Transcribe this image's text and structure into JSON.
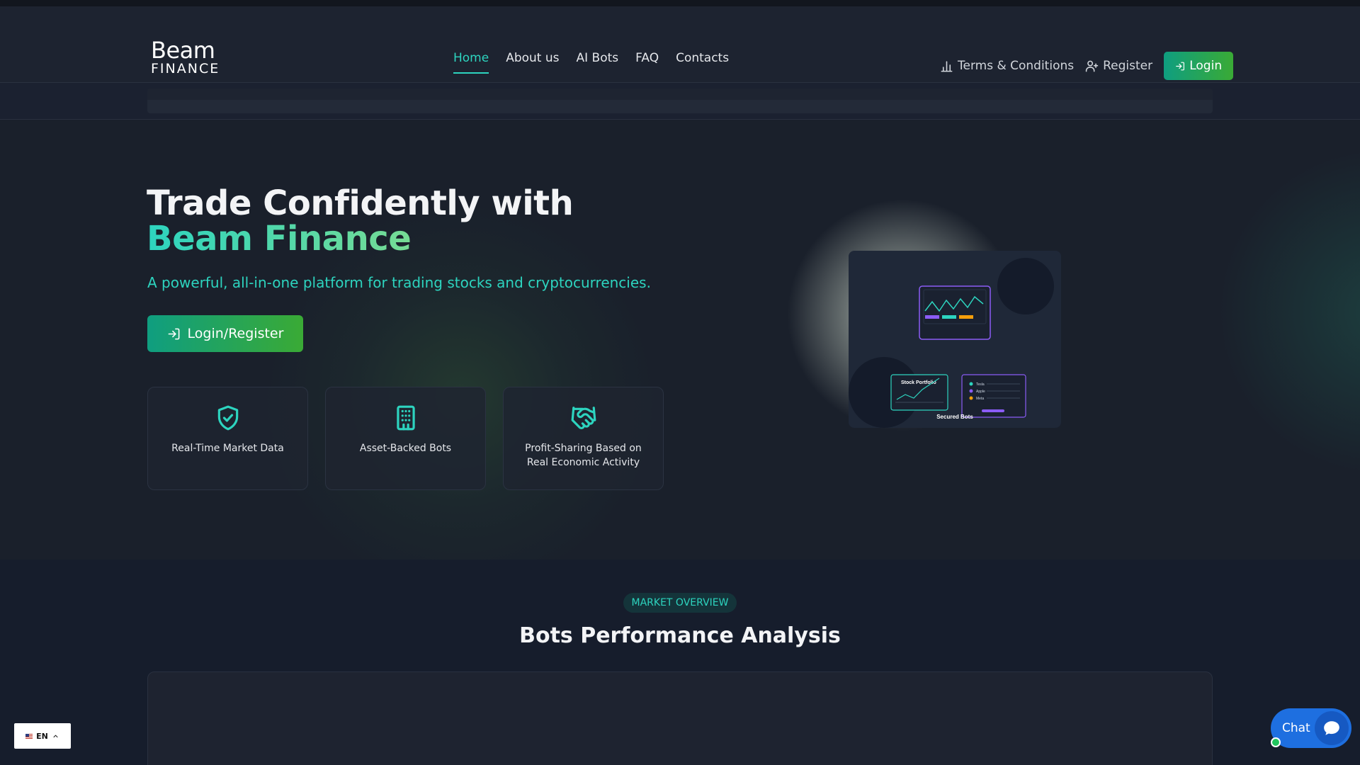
{
  "brand": {
    "logo_top": "Beam",
    "logo_bottom": "FINANCE"
  },
  "nav": {
    "items": [
      {
        "label": "Home",
        "active": true
      },
      {
        "label": "About us",
        "active": false
      },
      {
        "label": "AI Bots",
        "active": false
      },
      {
        "label": "FAQ",
        "active": false
      },
      {
        "label": "Contacts",
        "active": false
      }
    ],
    "terms_label": "Terms & Conditions",
    "register_label": "Register",
    "login_label": "Login"
  },
  "hero": {
    "title_line1": "Trade Confidently with",
    "title_line2": "Beam Finance",
    "subtitle": "A powerful, all-in-one platform for trading stocks and cryptocurrencies.",
    "cta_label": "Login/Register",
    "features": [
      {
        "icon": "shield-check-icon",
        "label": "Real-Time Market Data"
      },
      {
        "icon": "building-icon",
        "label": "Asset-Backed Bots"
      },
      {
        "icon": "handshake-icon",
        "label": "Profit-Sharing Based on Real Economic Activity"
      }
    ],
    "illustration": {
      "portfolio_label": "Stock Portfolio",
      "list_items": [
        "Tesla",
        "Apple",
        "Meta"
      ],
      "caption": "Secured Bots"
    }
  },
  "market": {
    "badge": "MARKET OVERVIEW",
    "title": "Bots Performance Analysis"
  },
  "widgets": {
    "language": "EN",
    "chat_label": "Chat"
  },
  "colors": {
    "accent": "#2dd4bf",
    "button_gradient_start": "#0f9e80",
    "button_gradient_end": "#3aaa35",
    "chat_blue": "#1e6fe0",
    "background": "#1a202b"
  }
}
